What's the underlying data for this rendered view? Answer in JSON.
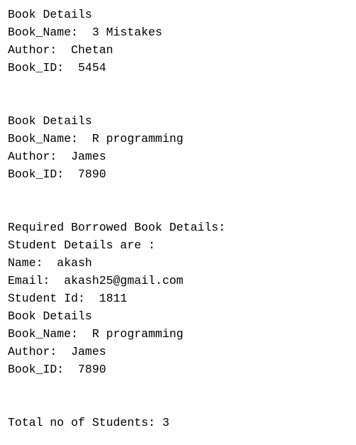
{
  "console": {
    "lines": [
      "Book Details",
      "Book_Name:  3 Mistakes",
      "Author:  Chetan",
      "Book_ID:  5454",
      "",
      "",
      "Book Details",
      "Book_Name:  R programming",
      "Author:  James",
      "Book_ID:  7890",
      "",
      "",
      "Required Borrowed Book Details:",
      "Student Details are :",
      "Name:  akash",
      "Email:  akash25@gmail.com",
      "Student Id:  1811",
      "Book Details",
      "Book_Name:  R programming",
      "Author:  James",
      "Book_ID:  7890",
      "",
      "",
      "Total no of Students: 3"
    ]
  }
}
